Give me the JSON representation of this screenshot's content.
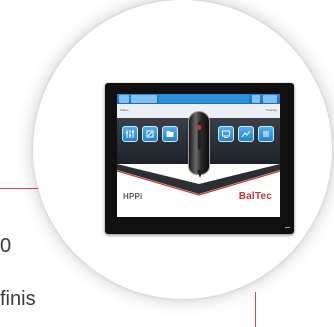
{
  "background_document": {
    "line_1": "0",
    "line_2": "finis"
  },
  "device": {
    "brand_logo": "BalTec",
    "product_logo": "HPPi",
    "status_left": "Status",
    "status_right": "Tuesday",
    "toolbar_icons": [
      "settings-icon",
      "wrench-icon",
      "folder-icon",
      "screen-icon",
      "chart-icon",
      "list-icon"
    ]
  },
  "colors": {
    "accent_blue": "#2a8bd2",
    "brand_red": "#c8342e",
    "rule_red": "#d84a46",
    "bezel": "#101010"
  }
}
